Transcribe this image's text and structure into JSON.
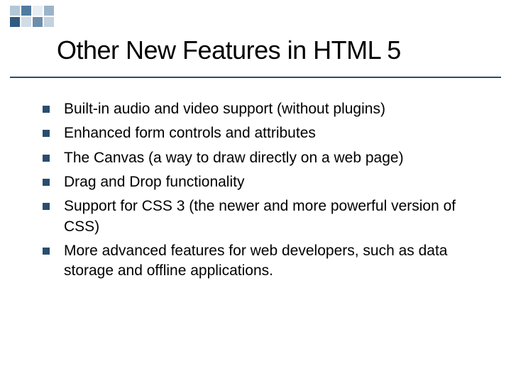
{
  "title": "Other New Features in HTML 5",
  "bullets": [
    "Built-in audio and video support (without plugins)",
    "Enhanced form controls and attributes",
    "The Canvas (a way to draw directly on a web page)",
    "Drag and Drop functionality",
    "Support for CSS 3 (the newer and more powerful version of CSS)",
    "More advanced features for web developers, such as data storage and offline applications."
  ]
}
